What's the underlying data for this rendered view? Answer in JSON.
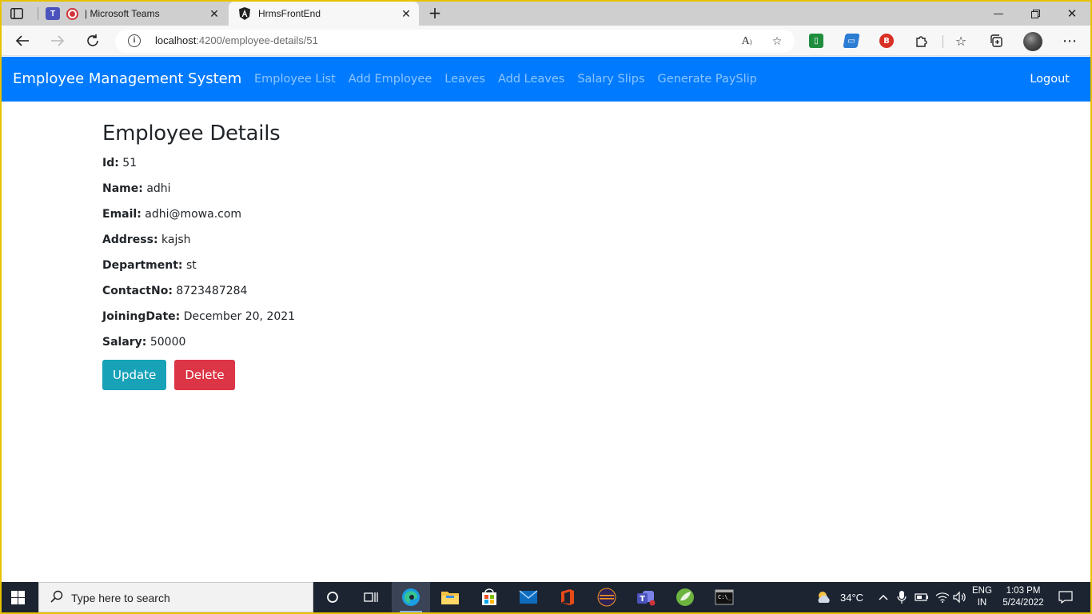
{
  "browser": {
    "tabs": [
      {
        "label": "| Microsoft Teams",
        "active": false
      },
      {
        "label": "HrmsFrontEnd",
        "active": true
      }
    ],
    "url_host": "localhost",
    "url_path": ":4200/employee-details/51"
  },
  "app": {
    "brand": "Employee Management System",
    "nav": [
      "Employee List",
      "Add Employee",
      "Leaves",
      "Add Leaves",
      "Salary Slips",
      "Generate PaySlip"
    ],
    "logout": "Logout"
  },
  "details": {
    "title": "Employee Details",
    "fields": [
      {
        "label": "Id:",
        "value": "51"
      },
      {
        "label": "Name:",
        "value": "adhi"
      },
      {
        "label": "Email:",
        "value": "adhi@mowa.com"
      },
      {
        "label": "Address:",
        "value": "kajsh"
      },
      {
        "label": "Department:",
        "value": "st"
      },
      {
        "label": "ContactNo:",
        "value": "8723487284"
      },
      {
        "label": "JoiningDate:",
        "value": "December 20, 2021"
      },
      {
        "label": "Salary:",
        "value": "50000"
      }
    ],
    "update_label": "Update",
    "delete_label": "Delete"
  },
  "taskbar": {
    "search_placeholder": "Type here to search",
    "weather": "34°C",
    "lang_top": "ENG",
    "lang_bottom": "IN",
    "time": "1:03 PM",
    "date": "5/24/2022"
  },
  "colors": {
    "navbar": "#007bff",
    "btn_update": "#17a2b8",
    "btn_delete": "#dc3545",
    "taskbar": "#1c2432"
  }
}
